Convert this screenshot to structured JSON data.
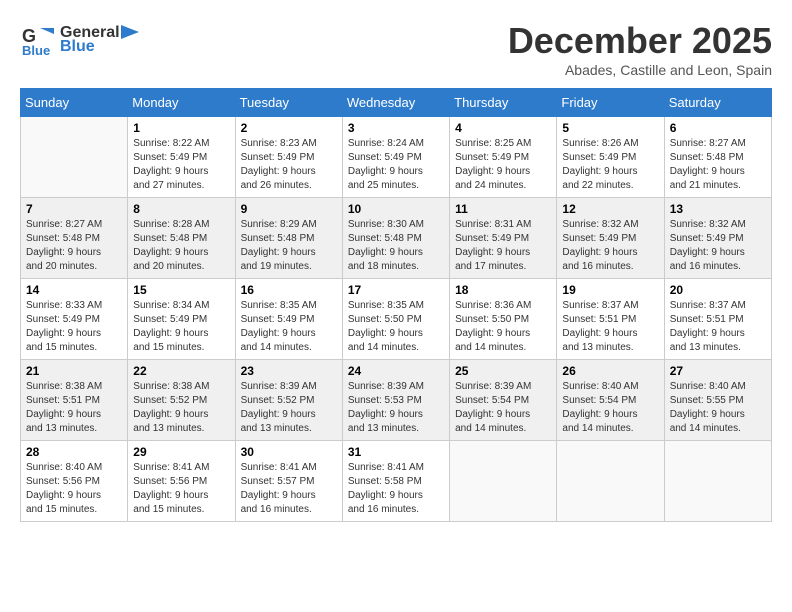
{
  "header": {
    "logo_general": "General",
    "logo_blue": "Blue",
    "month_title": "December 2025",
    "location": "Abades, Castille and Leon, Spain"
  },
  "days_of_week": [
    "Sunday",
    "Monday",
    "Tuesday",
    "Wednesday",
    "Thursday",
    "Friday",
    "Saturday"
  ],
  "weeks": [
    [
      {
        "day": "",
        "info": ""
      },
      {
        "day": "1",
        "info": "Sunrise: 8:22 AM\nSunset: 5:49 PM\nDaylight: 9 hours\nand 27 minutes."
      },
      {
        "day": "2",
        "info": "Sunrise: 8:23 AM\nSunset: 5:49 PM\nDaylight: 9 hours\nand 26 minutes."
      },
      {
        "day": "3",
        "info": "Sunrise: 8:24 AM\nSunset: 5:49 PM\nDaylight: 9 hours\nand 25 minutes."
      },
      {
        "day": "4",
        "info": "Sunrise: 8:25 AM\nSunset: 5:49 PM\nDaylight: 9 hours\nand 24 minutes."
      },
      {
        "day": "5",
        "info": "Sunrise: 8:26 AM\nSunset: 5:49 PM\nDaylight: 9 hours\nand 22 minutes."
      },
      {
        "day": "6",
        "info": "Sunrise: 8:27 AM\nSunset: 5:48 PM\nDaylight: 9 hours\nand 21 minutes."
      }
    ],
    [
      {
        "day": "7",
        "info": "Sunrise: 8:27 AM\nSunset: 5:48 PM\nDaylight: 9 hours\nand 20 minutes."
      },
      {
        "day": "8",
        "info": "Sunrise: 8:28 AM\nSunset: 5:48 PM\nDaylight: 9 hours\nand 20 minutes."
      },
      {
        "day": "9",
        "info": "Sunrise: 8:29 AM\nSunset: 5:48 PM\nDaylight: 9 hours\nand 19 minutes."
      },
      {
        "day": "10",
        "info": "Sunrise: 8:30 AM\nSunset: 5:48 PM\nDaylight: 9 hours\nand 18 minutes."
      },
      {
        "day": "11",
        "info": "Sunrise: 8:31 AM\nSunset: 5:49 PM\nDaylight: 9 hours\nand 17 minutes."
      },
      {
        "day": "12",
        "info": "Sunrise: 8:32 AM\nSunset: 5:49 PM\nDaylight: 9 hours\nand 16 minutes."
      },
      {
        "day": "13",
        "info": "Sunrise: 8:32 AM\nSunset: 5:49 PM\nDaylight: 9 hours\nand 16 minutes."
      }
    ],
    [
      {
        "day": "14",
        "info": "Sunrise: 8:33 AM\nSunset: 5:49 PM\nDaylight: 9 hours\nand 15 minutes."
      },
      {
        "day": "15",
        "info": "Sunrise: 8:34 AM\nSunset: 5:49 PM\nDaylight: 9 hours\nand 15 minutes."
      },
      {
        "day": "16",
        "info": "Sunrise: 8:35 AM\nSunset: 5:49 PM\nDaylight: 9 hours\nand 14 minutes."
      },
      {
        "day": "17",
        "info": "Sunrise: 8:35 AM\nSunset: 5:50 PM\nDaylight: 9 hours\nand 14 minutes."
      },
      {
        "day": "18",
        "info": "Sunrise: 8:36 AM\nSunset: 5:50 PM\nDaylight: 9 hours\nand 14 minutes."
      },
      {
        "day": "19",
        "info": "Sunrise: 8:37 AM\nSunset: 5:51 PM\nDaylight: 9 hours\nand 13 minutes."
      },
      {
        "day": "20",
        "info": "Sunrise: 8:37 AM\nSunset: 5:51 PM\nDaylight: 9 hours\nand 13 minutes."
      }
    ],
    [
      {
        "day": "21",
        "info": "Sunrise: 8:38 AM\nSunset: 5:51 PM\nDaylight: 9 hours\nand 13 minutes."
      },
      {
        "day": "22",
        "info": "Sunrise: 8:38 AM\nSunset: 5:52 PM\nDaylight: 9 hours\nand 13 minutes."
      },
      {
        "day": "23",
        "info": "Sunrise: 8:39 AM\nSunset: 5:52 PM\nDaylight: 9 hours\nand 13 minutes."
      },
      {
        "day": "24",
        "info": "Sunrise: 8:39 AM\nSunset: 5:53 PM\nDaylight: 9 hours\nand 13 minutes."
      },
      {
        "day": "25",
        "info": "Sunrise: 8:39 AM\nSunset: 5:54 PM\nDaylight: 9 hours\nand 14 minutes."
      },
      {
        "day": "26",
        "info": "Sunrise: 8:40 AM\nSunset: 5:54 PM\nDaylight: 9 hours\nand 14 minutes."
      },
      {
        "day": "27",
        "info": "Sunrise: 8:40 AM\nSunset: 5:55 PM\nDaylight: 9 hours\nand 14 minutes."
      }
    ],
    [
      {
        "day": "28",
        "info": "Sunrise: 8:40 AM\nSunset: 5:56 PM\nDaylight: 9 hours\nand 15 minutes."
      },
      {
        "day": "29",
        "info": "Sunrise: 8:41 AM\nSunset: 5:56 PM\nDaylight: 9 hours\nand 15 minutes."
      },
      {
        "day": "30",
        "info": "Sunrise: 8:41 AM\nSunset: 5:57 PM\nDaylight: 9 hours\nand 16 minutes."
      },
      {
        "day": "31",
        "info": "Sunrise: 8:41 AM\nSunset: 5:58 PM\nDaylight: 9 hours\nand 16 minutes."
      },
      {
        "day": "",
        "info": ""
      },
      {
        "day": "",
        "info": ""
      },
      {
        "day": "",
        "info": ""
      }
    ]
  ]
}
